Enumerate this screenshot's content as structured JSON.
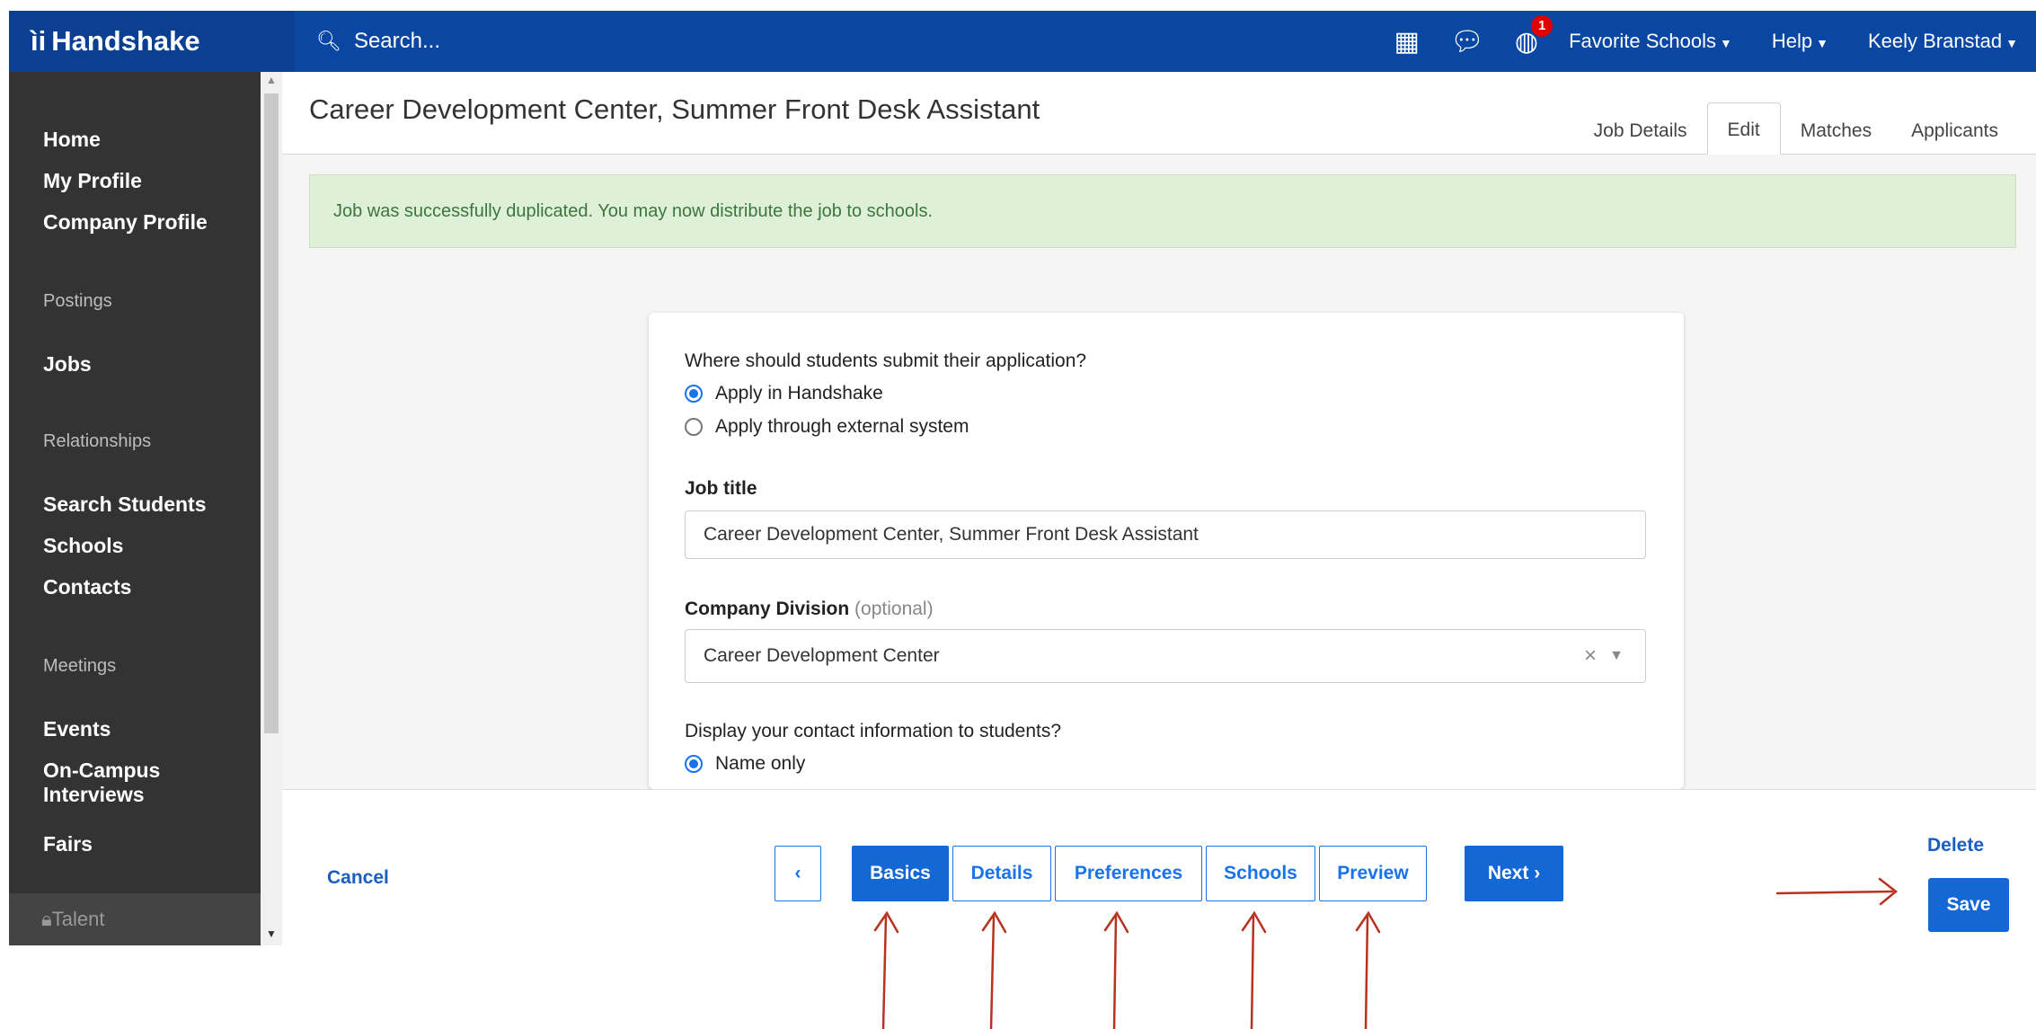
{
  "topbar": {
    "brand": "Handshake",
    "brand_icon": "handshake-logo",
    "search_placeholder": "Search...",
    "notification_count": "1",
    "favorite_schools": "Favorite Schools",
    "help": "Help",
    "user": "Keely Branstad"
  },
  "sidebar": {
    "items": [
      {
        "label": "Home"
      },
      {
        "label": "My Profile"
      },
      {
        "label": "Company Profile"
      }
    ],
    "postings_header": "Postings",
    "jobs": "Jobs",
    "relationships_header": "Relationships",
    "search_students": "Search Students",
    "schools": "Schools",
    "contacts": "Contacts",
    "meetings_header": "Meetings",
    "events": "Events",
    "oncampus_line1": "On-Campus",
    "oncampus_line2": "Interviews",
    "fairs": "Fairs",
    "talent": "Talent"
  },
  "main": {
    "title": "Career Development Center, Summer Front Desk Assistant",
    "tabs": [
      "Job Details",
      "Edit",
      "Matches",
      "Applicants"
    ],
    "alert": "Job was successfully duplicated. You may now distribute the job to schools."
  },
  "form": {
    "submit_question": "Where should students submit their application?",
    "apply_handshake": "Apply in Handshake",
    "apply_external": "Apply through external system",
    "job_title_label": "Job title",
    "job_title_value": "Career Development Center, Summer Front Desk Assistant",
    "division_label": "Company Division",
    "division_optional": "(optional)",
    "division_value": "Career Development Center",
    "contact_question": "Display your contact information to students?",
    "name_only": "Name only"
  },
  "footer": {
    "cancel": "Cancel",
    "prev": "‹",
    "steps": [
      "Basics",
      "Details",
      "Preferences",
      "Schools",
      "Preview"
    ],
    "next": "Next",
    "delete": "Delete",
    "save": "Save"
  },
  "colors": {
    "topbar": "#0a47a3",
    "sidebar": "#333333",
    "primary": "#1468d6",
    "alert_bg": "#dff0d8",
    "annotation": "#b8321f"
  }
}
